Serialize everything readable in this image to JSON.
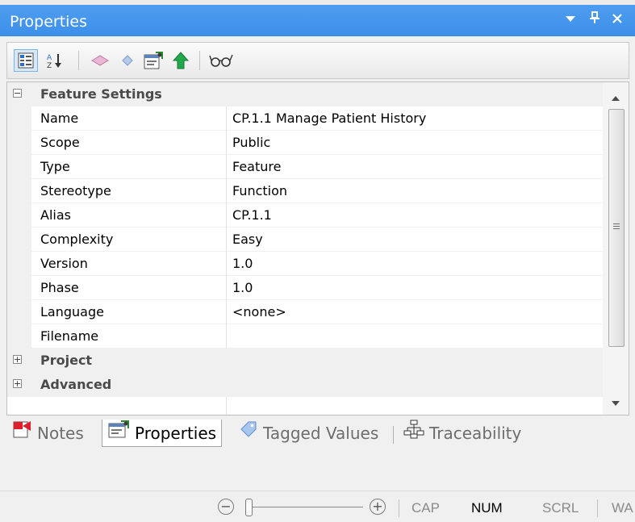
{
  "window": {
    "title": "Properties",
    "controls": [
      "dropdown-icon",
      "pin-icon",
      "close-icon"
    ],
    "accent_color": "#3c8fe9"
  },
  "toolbar": {
    "buttons": [
      {
        "icon": "categorized-view-icon",
        "active": true
      },
      {
        "icon": "sort-alphabetical-icon",
        "active": false
      },
      {
        "icon": "tagged-value-icon",
        "active": false
      },
      {
        "icon": "tagged-value-blue-icon",
        "active": false
      },
      {
        "icon": "properties-dialog-icon",
        "active": false
      },
      {
        "icon": "navigate-up-icon",
        "active": false
      },
      {
        "icon": "glasses-icon",
        "active": false
      }
    ]
  },
  "grid": {
    "categories": [
      {
        "label": "Feature Settings",
        "expanded": true,
        "toggle": "−",
        "properties": [
          {
            "name": "Name",
            "value": "CP.1.1 Manage Patient History"
          },
          {
            "name": "Scope",
            "value": "Public"
          },
          {
            "name": "Type",
            "value": "Feature"
          },
          {
            "name": "Stereotype",
            "value": "Function"
          },
          {
            "name": "Alias",
            "value": "CP.1.1"
          },
          {
            "name": "Complexity",
            "value": "Easy"
          },
          {
            "name": "Version",
            "value": "1.0"
          },
          {
            "name": "Phase",
            "value": "1.0"
          },
          {
            "name": "Language",
            "value": "<none>"
          },
          {
            "name": "Filename",
            "value": ""
          }
        ]
      },
      {
        "label": "Project",
        "expanded": false,
        "toggle": "+"
      },
      {
        "label": "Advanced",
        "expanded": false,
        "toggle": "+"
      }
    ]
  },
  "tabs": [
    {
      "label": "Notes",
      "icon": "notes-icon",
      "active": false
    },
    {
      "label": "Properties",
      "icon": "properties-icon",
      "active": true
    },
    {
      "label": "Tagged Values",
      "icon": "tag-icon",
      "active": false
    },
    {
      "label": "Traceability",
      "icon": "traceability-icon",
      "active": false
    }
  ],
  "status_bar": {
    "zoom_out": "−",
    "zoom_in": "+",
    "indicators": [
      {
        "label": "CAP",
        "on": false
      },
      {
        "label": "NUM",
        "on": true
      },
      {
        "label": "SCRL",
        "on": false
      },
      {
        "label": "WA",
        "on": false
      }
    ]
  }
}
